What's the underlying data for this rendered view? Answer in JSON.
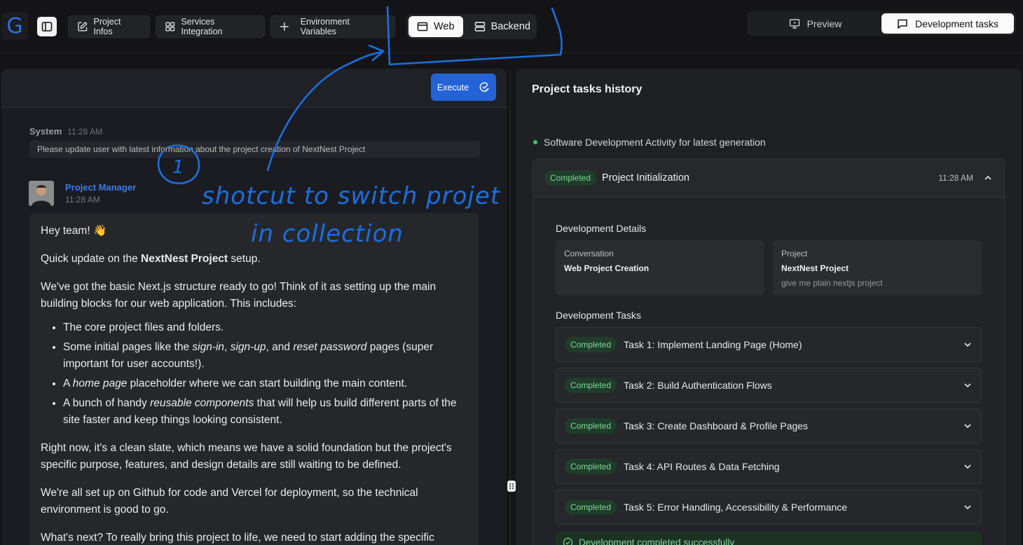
{
  "topbar": {
    "logo_letter": "G",
    "buttons": {
      "project_infos": "Project Infos",
      "services": "Services Integration",
      "env_vars": "Environment Variables"
    },
    "segment": {
      "web": "Web",
      "backend": "Backend"
    },
    "right_segment": {
      "preview": "Preview",
      "dev_tasks": "Development tasks"
    }
  },
  "chat": {
    "execute_label": "Execute",
    "system": {
      "sender": "System",
      "time": "11:28 AM",
      "text": "Please update user with latest information about the project creation of NextNest Project"
    },
    "pm": {
      "sender": "Project Manager",
      "time": "11:28 AM"
    },
    "message": {
      "greeting": "Hey team! 👋",
      "p1_pre": "Quick update on the ",
      "p1_bold": "NextNest Project",
      "p1_post": " setup.",
      "p2": "We've got the basic Next.js structure ready to go! Think of it as setting up the main building blocks for our web application. This includes:",
      "li1": "The core project files and folders.",
      "li2_a": "Some initial pages like the ",
      "li2_i1": "sign-in",
      "li2_b": ", ",
      "li2_i2": "sign-up",
      "li2_c": ", and ",
      "li2_i3": "reset password",
      "li2_d": " pages (super important for user accounts!).",
      "li3_a": "A ",
      "li3_i": "home page",
      "li3_b": " placeholder where we can start building the main content.",
      "li4_a": "A bunch of handy ",
      "li4_i": "reusable components",
      "li4_b": " that will help us build different parts of the site faster and keep things looking consistent.",
      "p3": "Right now, it's a clean slate, which means we have a solid foundation but the project's specific purpose, features, and design details are still waiting to be defined.",
      "p4": "We're all set up on Github for code and Vercel for deployment, so the technical environment is good to go.",
      "p5": "What's next? To really bring this project to life, we need to start adding the specific"
    }
  },
  "annotation": {
    "number": "1",
    "line1": "shotcut to switch projet",
    "line2": "in collection"
  },
  "history": {
    "title": "Project tasks history",
    "activity": "Software Development Activity for latest generation",
    "status": "Completed",
    "init_title": "Project Initialization",
    "init_time": "11:28 AM",
    "details_heading": "Development Details",
    "conversation_label": "Conversation",
    "conversation_value": "Web Project Creation",
    "project_label": "Project",
    "project_value": "NextNest Project",
    "project_desc": "give me plain nextjs project",
    "tasks_heading": "Development Tasks",
    "tasks": [
      "Task 1: Implement Landing Page (Home)",
      "Task 2: Build Authentication Flows",
      "Task 3: Create Dashboard & Profile Pages",
      "Task 4: API Routes & Data Fetching",
      "Task 5: Error Handling, Accessibility & Performance"
    ],
    "done": "Development completed successfully"
  },
  "colors": {
    "accent": "#2463d6",
    "success_bg": "#1f3d2a",
    "success_text": "#7fd89a",
    "annotation_ink": "#1a6fe0"
  }
}
